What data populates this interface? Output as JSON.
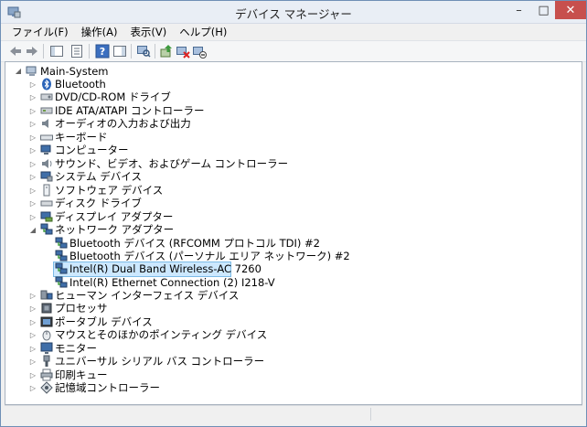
{
  "window": {
    "title": "デバイス マネージャー"
  },
  "menu": [
    {
      "label": "ファイル(F)"
    },
    {
      "label": "操作(A)"
    },
    {
      "label": "表示(V)"
    },
    {
      "label": "ヘルプ(H)"
    }
  ],
  "tree": {
    "root": "Main-System",
    "categories": [
      {
        "label": "Bluetooth",
        "icon": "bluetooth-icon"
      },
      {
        "label": "DVD/CD-ROM ドライブ",
        "icon": "dvd-drive-icon"
      },
      {
        "label": "IDE ATA/ATAPI コントローラー",
        "icon": "ide-controller-icon"
      },
      {
        "label": "オーディオの入力および出力",
        "icon": "speaker-icon"
      },
      {
        "label": "キーボード",
        "icon": "keyboard-icon"
      },
      {
        "label": "コンピューター",
        "icon": "computer-icon"
      },
      {
        "label": "サウンド、ビデオ、およびゲーム コントローラー",
        "icon": "sound-icon"
      },
      {
        "label": "システム デバイス",
        "icon": "system-device-icon"
      },
      {
        "label": "ソフトウェア デバイス",
        "icon": "software-device-icon"
      },
      {
        "label": "ディスク ドライブ",
        "icon": "disk-drive-icon"
      },
      {
        "label": "ディスプレイ アダプター",
        "icon": "display-adapter-icon"
      },
      {
        "label": "ネットワーク アダプター",
        "icon": "network-adapter-icon"
      },
      {
        "label": "ヒューマン インターフェイス デバイス",
        "icon": "hid-icon"
      },
      {
        "label": "プロセッサ",
        "icon": "processor-icon"
      },
      {
        "label": "ポータブル デバイス",
        "icon": "portable-device-icon"
      },
      {
        "label": "マウスとそのほかのポインティング デバイス",
        "icon": "mouse-icon"
      },
      {
        "label": "モニター",
        "icon": "monitor-icon"
      },
      {
        "label": "ユニバーサル シリアル バス コントローラー",
        "icon": "usb-icon"
      },
      {
        "label": "印刷キュー",
        "icon": "printer-icon"
      },
      {
        "label": "記憶域コントローラー",
        "icon": "storage-controller-icon"
      }
    ],
    "network_children": [
      {
        "label": "Bluetooth デバイス (RFCOMM プロトコル TDI) #2"
      },
      {
        "label": "Bluetooth デバイス (パーソナル エリア ネットワーク) #2"
      },
      {
        "label": "Intel(R) Dual Band Wireless-AC 7260",
        "selected": true
      },
      {
        "label": "Intel(R) Ethernet Connection (2) I218-V"
      }
    ]
  },
  "colors": {
    "selection_bg": "#cce8ff",
    "selection_border": "#7cbbe6",
    "close_button": "#c7504d"
  }
}
